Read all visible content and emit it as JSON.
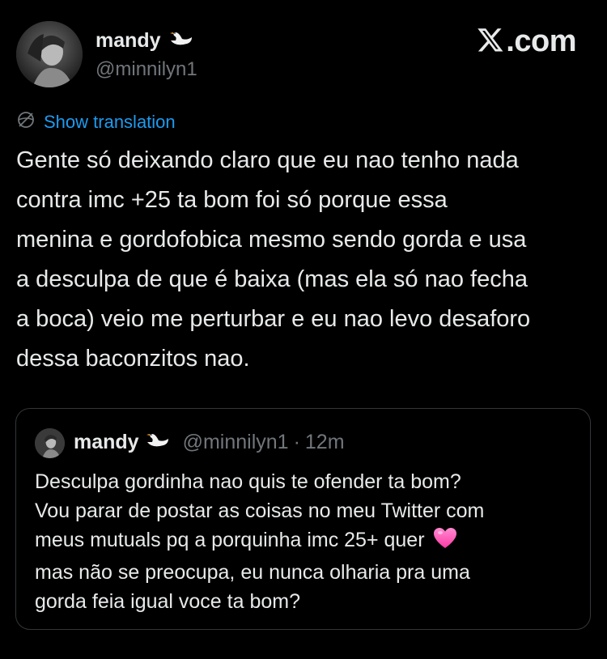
{
  "header": {
    "display_name": "mandy",
    "handle": "@minnilyn1",
    "brand": ".com",
    "brand_icon": "x-logo-icon",
    "name_emoji": "swan-icon",
    "avatar_icon": "avatar-photo"
  },
  "translation": {
    "label": "Show translation",
    "icon": "globe-icon"
  },
  "tweet": {
    "lines": [
      "Gente só deixando claro que eu nao tenho nada",
      "contra imc +25 ta bom foi só porque essa",
      "menina e gordofobica mesmo sendo gorda e usa",
      "a desculpa de que é baixa (mas ela só nao fecha",
      "a boca) veio me perturbar e eu nao levo desaforo",
      "dessa baconzitos nao."
    ]
  },
  "quote": {
    "display_name": "mandy",
    "handle": "@minnilyn1",
    "separator": "·",
    "time": "12m",
    "lines": [
      "Desculpa gordinha nao quis te ofender ta bom?",
      "Vou parar de postar as coisas no meu Twitter com",
      "meus mutuals pq a porquinha imc 25+ quer",
      "mas não se preocupa, eu nunca olharia pra uma",
      "gorda feia igual voce ta bom?"
    ],
    "line3_emoji": "pink-heart-icon"
  },
  "colors": {
    "background": "#000000",
    "text": "#e7e9ea",
    "secondary": "#71767b",
    "link": "#1d9bf0",
    "border": "#333639",
    "heart": "#ff4fb8"
  }
}
